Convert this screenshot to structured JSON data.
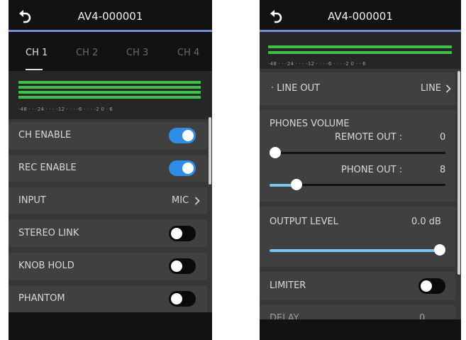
{
  "colors": {
    "accent": "#2f8ee6",
    "meter_green": "#3ec04a",
    "header_underline": "#6f8fd6",
    "slider_fill": "#72c8f0"
  },
  "screen1": {
    "title": "AV4-000001",
    "back_icon": "back-arrow-icon",
    "tabs": [
      {
        "label": "CH 1",
        "active": true
      },
      {
        "label": "CH 2",
        "active": false
      },
      {
        "label": "CH 3",
        "active": false
      },
      {
        "label": "CH 4",
        "active": false
      }
    ],
    "meter_scale": "-48  ·  ·  -24  ·  ·  ·  -12  ·  ·  ·  -6  ·  ·  ·  -2  0  ·  6",
    "rows": [
      {
        "label": "CH ENABLE",
        "toggle": true
      },
      {
        "label": "REC ENABLE",
        "toggle": true
      },
      {
        "label": "INPUT",
        "value": "MIC",
        "chevron": "chevron-right-icon"
      },
      {
        "label": "STEREO LINK",
        "toggle": false
      },
      {
        "label": "KNOB HOLD",
        "toggle": false
      },
      {
        "label": "PHANTOM",
        "toggle": false
      }
    ]
  },
  "screen2": {
    "title": "AV4-000001",
    "back_icon": "back-arrow-icon",
    "meter_scale": "-48  ·  ·  -24  ·  ·  ·  -12  ·  ·  ·  -6  ·  ·  ·  -2  0  ·  ·  6",
    "line_out": {
      "label": "· LINE OUT",
      "value": "LINE",
      "chevron": "chevron-right-icon"
    },
    "phones_volume": {
      "label": "PHONES VOLUME",
      "remote_out_label": "REMOTE OUT :",
      "remote_out_value": "0",
      "remote_out_level": 0.0,
      "phone_out_label": "PHONE OUT :",
      "phone_out_value": "8",
      "phone_out_level": 0.15
    },
    "output_level": {
      "label": "OUTPUT LEVEL",
      "value": "0.0 dB",
      "level": 1.0
    },
    "limiter": {
      "label": "LIMITER",
      "toggle": false
    },
    "partial_row": {
      "label": "DELAY",
      "value": "0"
    }
  }
}
